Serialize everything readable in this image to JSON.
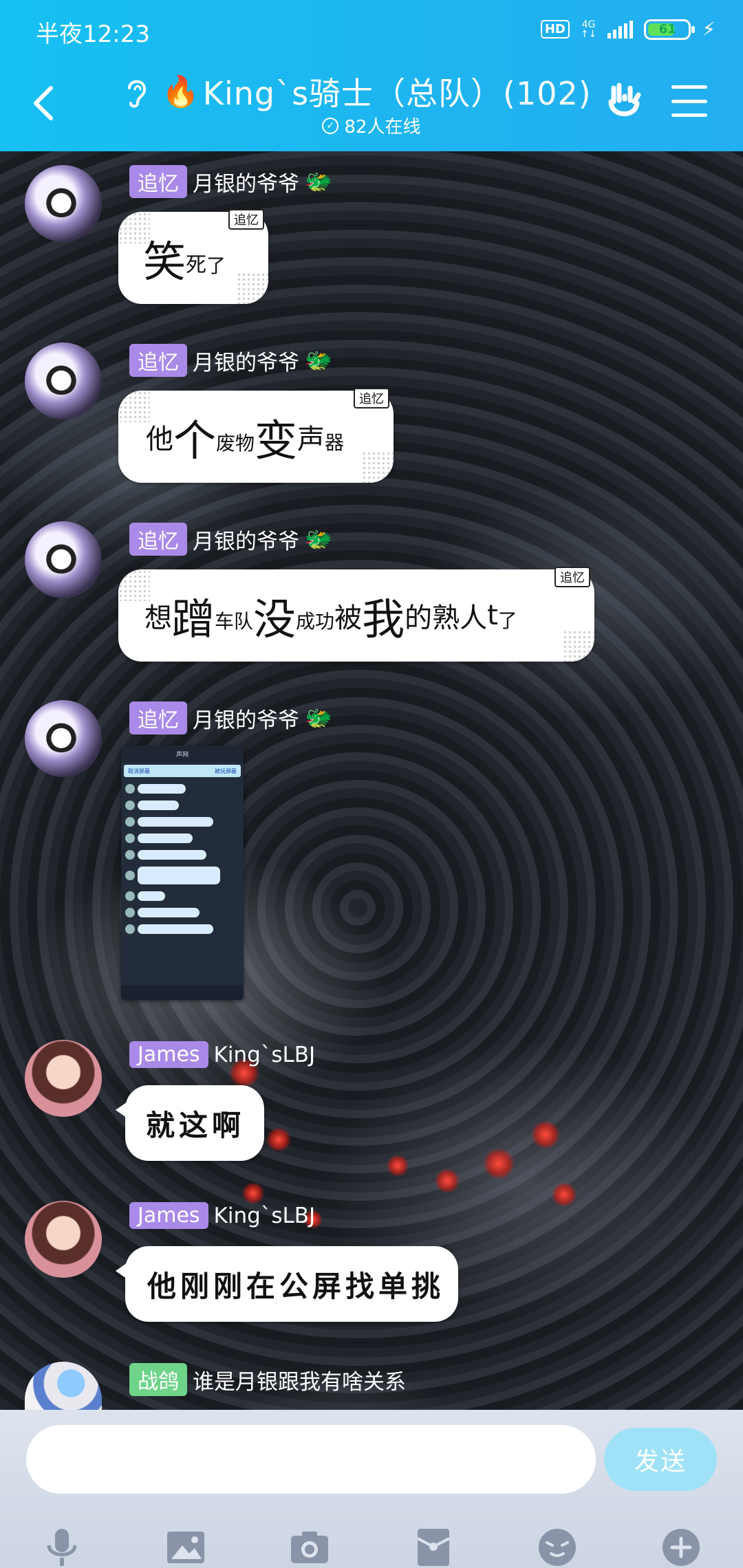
{
  "status_bar": {
    "time": "半夜12:23",
    "hd": "HD",
    "network": "4G",
    "battery": "61"
  },
  "header": {
    "title": "King`s骑士（总队）(102)",
    "fire_emoji": "🔥",
    "online": "82人在线"
  },
  "messages": [
    {
      "tag": "追忆",
      "name": "月银的爷爷",
      "mini_tag": "追忆",
      "parts": [
        "笑",
        "死",
        "了"
      ]
    },
    {
      "tag": "追忆",
      "name": "月银的爷爷",
      "mini_tag": "追忆",
      "parts": [
        "他",
        "个",
        "废物",
        "变",
        "声",
        "器"
      ]
    },
    {
      "tag": "追忆",
      "name": "月银的爷爷",
      "mini_tag": "追忆",
      "parts": [
        "想",
        "蹭",
        "车队",
        "没",
        "成功",
        "被",
        "我",
        "的熟人",
        "t",
        "了"
      ]
    },
    {
      "tag": "追忆",
      "name": "月银的爷爷",
      "image_title": "声网",
      "image_tab_left": "取消屏蔽",
      "image_tab_right": "被玩屏蔽"
    },
    {
      "tag": "James",
      "name": "King`sLBJ",
      "text": "就这啊"
    },
    {
      "tag": "James",
      "name": "King`sLBJ",
      "text": "他刚刚在公屏找单挑"
    },
    {
      "tag": "战鸽",
      "name": "谁是月银跟我有啥关系"
    }
  ],
  "input": {
    "placeholder": "",
    "send_label": "发送"
  },
  "colors": {
    "header": "#1fb4f0",
    "tag_purple": "#a98ae8",
    "tag_green": "#6fd48a",
    "send": "#9fe2f7"
  }
}
